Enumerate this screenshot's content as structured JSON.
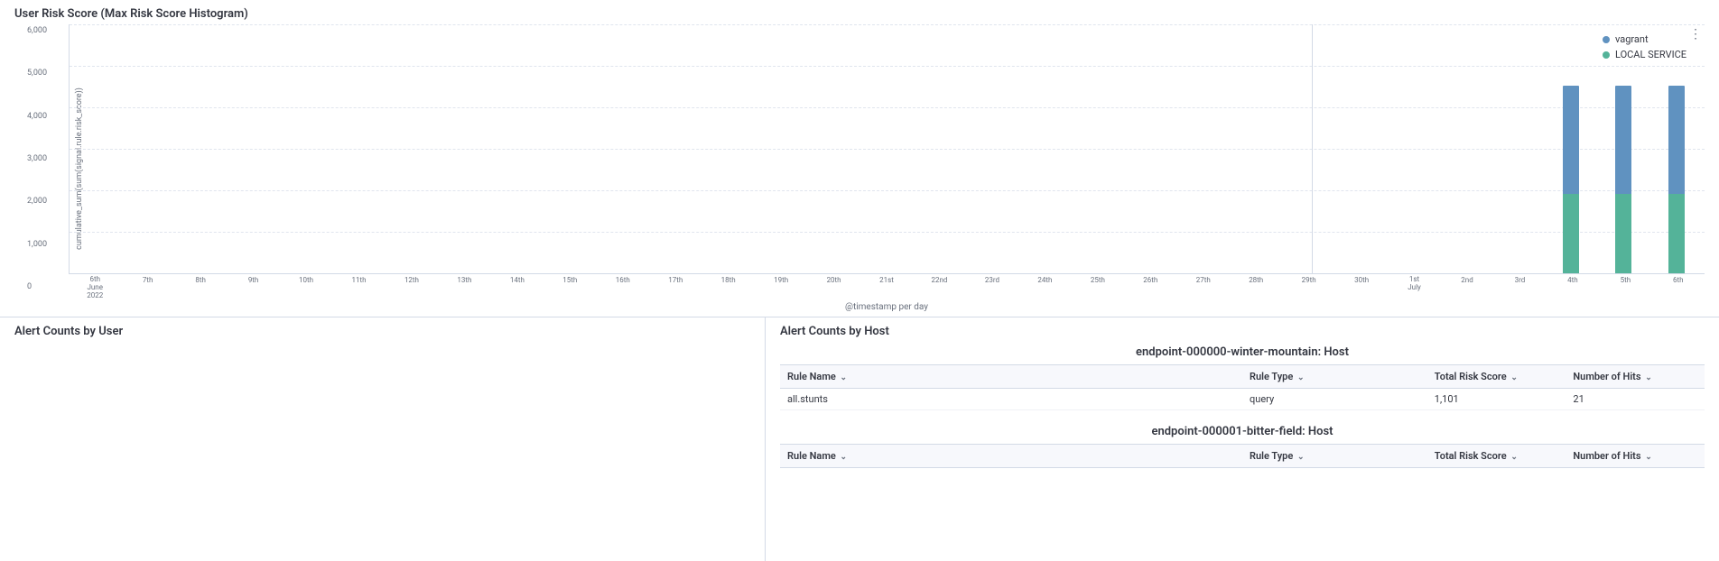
{
  "chartSection": {
    "title": "User Risk Score (Max Risk Score Histogram)",
    "yAxisLabel": "cumulative_sum(sum(signal.rule.risk_score))",
    "yTicks": [
      "6,000",
      "5,000",
      "4,000",
      "3,000",
      "2,000",
      "1,000",
      "0"
    ],
    "xAxisLabel": "@timestamp per day",
    "xTicks": [
      {
        "label": "6th\nJune\n2022",
        "multi": true
      },
      {
        "label": "7th"
      },
      {
        "label": "8th"
      },
      {
        "label": "9th"
      },
      {
        "label": "10th"
      },
      {
        "label": "11th"
      },
      {
        "label": "12th"
      },
      {
        "label": "13th"
      },
      {
        "label": "14th"
      },
      {
        "label": "15th"
      },
      {
        "label": "16th"
      },
      {
        "label": "17th"
      },
      {
        "label": "18th"
      },
      {
        "label": "19th"
      },
      {
        "label": "20th"
      },
      {
        "label": "21st"
      },
      {
        "label": "22nd"
      },
      {
        "label": "23rd"
      },
      {
        "label": "24th"
      },
      {
        "label": "25th"
      },
      {
        "label": "26th"
      },
      {
        "label": "27th"
      },
      {
        "label": "28th"
      },
      {
        "label": "29th"
      },
      {
        "label": "30th"
      },
      {
        "label": "1st\nJuly",
        "multi": true
      },
      {
        "label": "2nd"
      },
      {
        "label": "3rd"
      },
      {
        "label": "4th"
      },
      {
        "label": "5th"
      },
      {
        "label": "6th"
      }
    ],
    "legend": [
      {
        "id": "vagrant",
        "label": "vagrant",
        "color": "#6092c0"
      },
      {
        "id": "local-service",
        "label": "LOCAL SERVICE",
        "color": "#54b399"
      }
    ],
    "bars": [
      {
        "vagrant": 0,
        "local": 0
      },
      {
        "vagrant": 0,
        "local": 0
      },
      {
        "vagrant": 0,
        "local": 0
      },
      {
        "vagrant": 0,
        "local": 0
      },
      {
        "vagrant": 0,
        "local": 0
      },
      {
        "vagrant": 0,
        "local": 0
      },
      {
        "vagrant": 0,
        "local": 0
      },
      {
        "vagrant": 0,
        "local": 0
      },
      {
        "vagrant": 0,
        "local": 0
      },
      {
        "vagrant": 0,
        "local": 0
      },
      {
        "vagrant": 0,
        "local": 0
      },
      {
        "vagrant": 0,
        "local": 0
      },
      {
        "vagrant": 0,
        "local": 0
      },
      {
        "vagrant": 0,
        "local": 0
      },
      {
        "vagrant": 0,
        "local": 0
      },
      {
        "vagrant": 0,
        "local": 0
      },
      {
        "vagrant": 0,
        "local": 0
      },
      {
        "vagrant": 0,
        "local": 0
      },
      {
        "vagrant": 0,
        "local": 0
      },
      {
        "vagrant": 0,
        "local": 0
      },
      {
        "vagrant": 0,
        "local": 0
      },
      {
        "vagrant": 0,
        "local": 0
      },
      {
        "vagrant": 0,
        "local": 0
      },
      {
        "vagrant": 0,
        "local": 0
      },
      {
        "vagrant": 0,
        "local": 0
      },
      {
        "vagrant": 0,
        "local": 0
      },
      {
        "vagrant": 0,
        "local": 0
      },
      {
        "vagrant": 0,
        "local": 0
      },
      {
        "vagrant": 4200,
        "local": 2000
      },
      {
        "vagrant": 4200,
        "local": 2000
      },
      {
        "vagrant": 4200,
        "local": 2000
      }
    ]
  },
  "bottomPanels": {
    "left": {
      "title": "Alert Counts by User"
    },
    "right": {
      "title": "Alert Counts by Host",
      "hosts": [
        {
          "name": "endpoint-000000-winter-mountain: Host",
          "columns": [
            "Rule Name",
            "Rule Type",
            "Total Risk Score",
            "Number of Hits"
          ],
          "rows": [
            {
              "ruleName": "all.stunts",
              "ruleType": "query",
              "totalRisk": "1,101",
              "hits": "21"
            }
          ]
        },
        {
          "name": "endpoint-000001-bitter-field: Host",
          "columns": [
            "Rule Name",
            "Rule Type",
            "Total Risk Score",
            "Number of Hits"
          ],
          "rows": []
        }
      ]
    }
  }
}
